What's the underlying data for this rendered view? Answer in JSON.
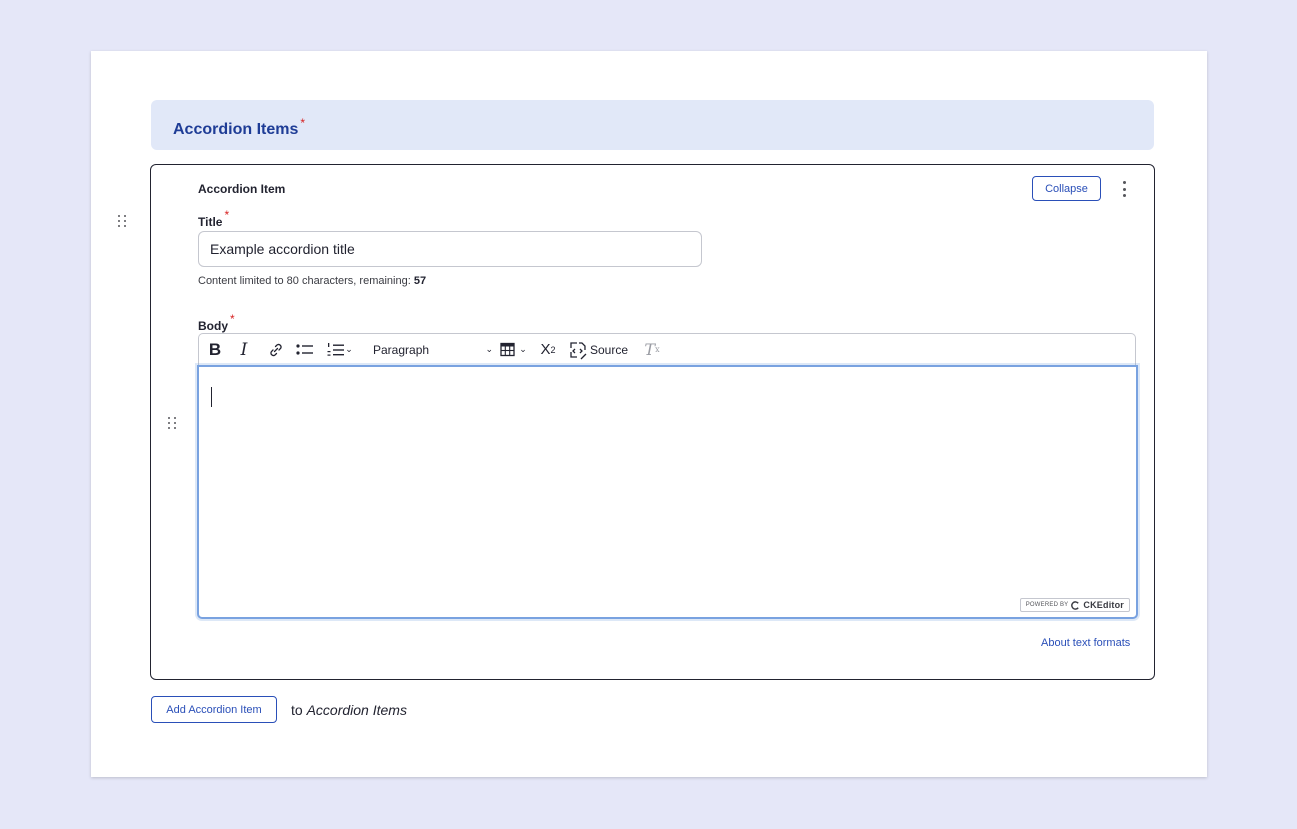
{
  "section": {
    "title": "Accordion Items",
    "required_mark": "*"
  },
  "item": {
    "label": "Accordion Item",
    "collapse_label": "Collapse",
    "title_field": {
      "label": "Title",
      "required_mark": "*",
      "value": "Example accordion title",
      "hint_prefix": "Content limited to 80 characters, remaining:",
      "remaining": "57"
    },
    "body_field": {
      "label": "Body",
      "required_mark": "*",
      "toolbar": {
        "bold": "B",
        "italic": "I",
        "format_value": "Paragraph",
        "superscript_base": "X",
        "superscript_exp": "2",
        "source_label": "Source",
        "clear_format": "T",
        "clear_format_sub": "x"
      },
      "content": "",
      "powered_by": "POWERED BY",
      "ckeditor_brand": "CKEditor"
    },
    "about_formats_link": "About text formats"
  },
  "add": {
    "button_label": "Add Accordion Item",
    "suffix_text": "to",
    "suffix_target": "Accordion Items"
  },
  "icons": {
    "drag_handle": "drag-handle-icon",
    "kebab": "kebab-menu-icon",
    "link": "link-icon",
    "bullet_list": "bulleted-list-icon",
    "numbered_list": "numbered-list-icon",
    "table": "table-icon",
    "source": "source-code-icon"
  },
  "colors": {
    "page_bg": "#e5e7f8",
    "header_bg": "#e1e8f8",
    "header_text": "#1e3c96",
    "accent": "#2a4fb8",
    "required": "#d72222",
    "focus_border": "#79a2e0"
  }
}
